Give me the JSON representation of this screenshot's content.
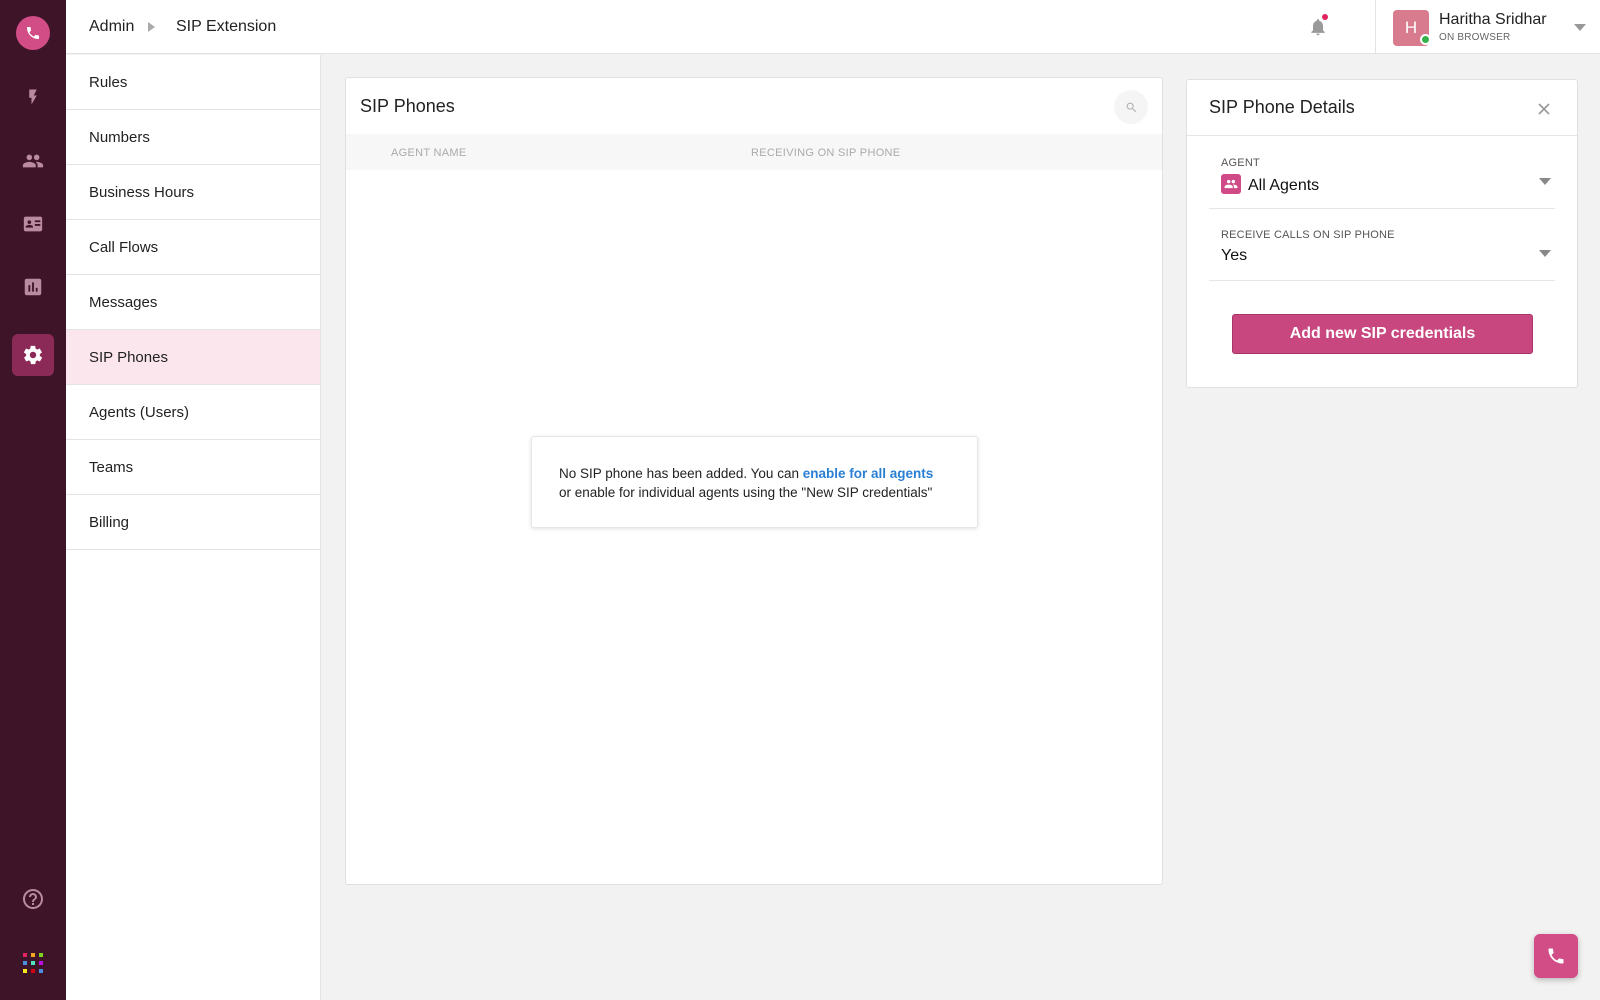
{
  "rail": {
    "items": [
      {
        "icon": "phone-icon"
      },
      {
        "icon": "bolt-icon"
      },
      {
        "icon": "contacts-icon"
      },
      {
        "icon": "card-icon"
      },
      {
        "icon": "reports-icon"
      },
      {
        "icon": "settings-icon",
        "active": true
      },
      {
        "icon": "help-icon"
      },
      {
        "icon": "apps-grid-icon"
      }
    ]
  },
  "breadcrumb": {
    "root": "Admin",
    "current": "SIP Extension"
  },
  "user": {
    "initial": "H",
    "name": "Haritha Sridhar",
    "status": "ON BROWSER"
  },
  "nav": {
    "items": [
      {
        "label": "Rules"
      },
      {
        "label": "Numbers"
      },
      {
        "label": "Business Hours"
      },
      {
        "label": "Call Flows"
      },
      {
        "label": "Messages"
      },
      {
        "label": "SIP Phones",
        "active": true
      },
      {
        "label": "Agents (Users)"
      },
      {
        "label": "Teams"
      },
      {
        "label": "Billing"
      }
    ]
  },
  "sip_phones": {
    "title": "SIP Phones",
    "columns": [
      "AGENT NAME",
      "RECEIVING ON SIP PHONE"
    ],
    "empty": {
      "text_before": "No SIP phone has been added. You can ",
      "link": "enable for all agents",
      "text_after": "or enable for individual agents using the \"New SIP credentials\""
    }
  },
  "details": {
    "title": "SIP Phone Details",
    "agent_label": "AGENT",
    "agent_value": "All Agents",
    "receive_label": "RECEIVE CALLS ON SIP PHONE",
    "receive_value": "Yes",
    "button": "Add new SIP credentials"
  },
  "colors": {
    "rail": "#3d1428",
    "accent": "#d24d86",
    "button": "#c9477f",
    "link": "#2a7fd4",
    "active_nav": "#fce6ee"
  }
}
